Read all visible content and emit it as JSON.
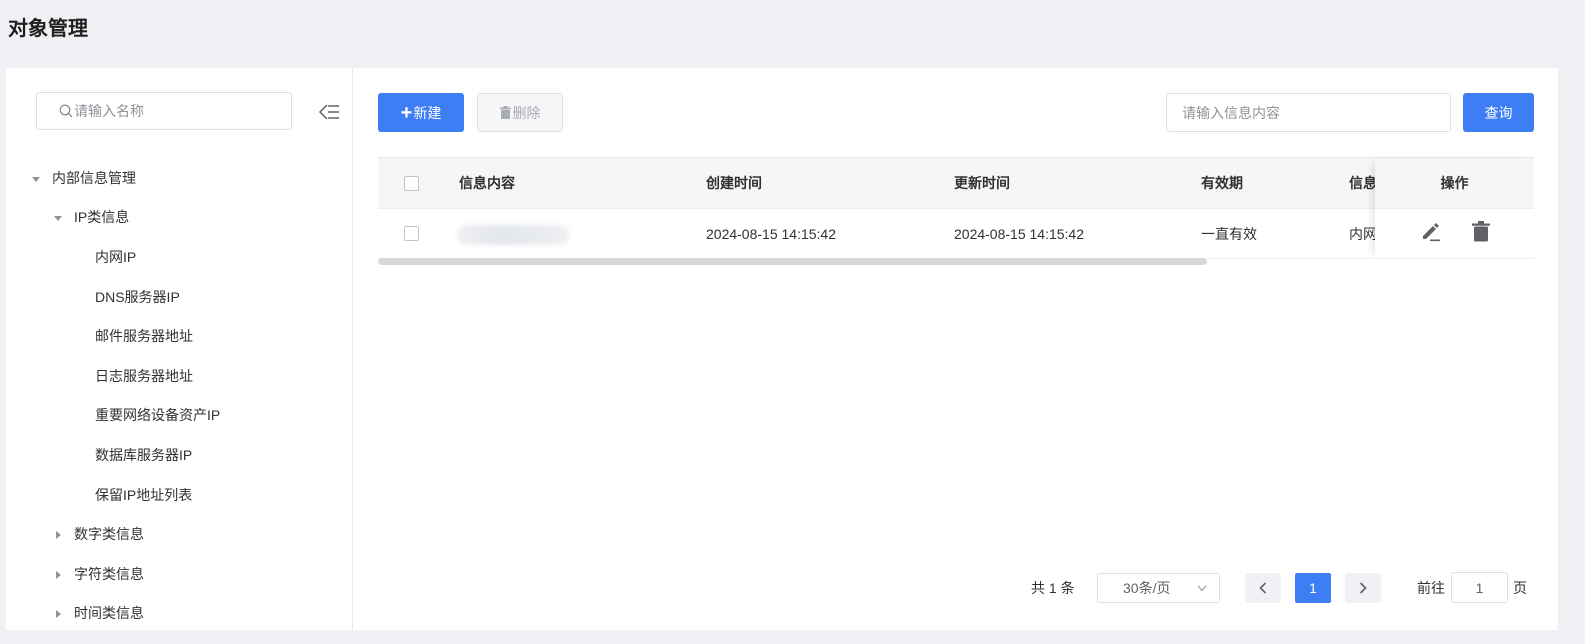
{
  "page": {
    "title": "对象管理"
  },
  "tree": {
    "search_placeholder": "请输入名称",
    "nodes": [
      {
        "label": "内部信息管理",
        "level": 1,
        "expanded": true
      },
      {
        "label": "IP类信息",
        "level": 2,
        "expanded": true
      },
      {
        "label": "内网IP",
        "level": 3
      },
      {
        "label": "DNS服务器IP",
        "level": 3
      },
      {
        "label": "邮件服务器地址",
        "level": 3
      },
      {
        "label": "日志服务器地址",
        "level": 3
      },
      {
        "label": "重要网络设备资产IP",
        "level": 3
      },
      {
        "label": "数据库服务器IP",
        "level": 3
      },
      {
        "label": "保留IP地址列表",
        "level": 3
      },
      {
        "label": "数字类信息",
        "level": 2,
        "expanded": false
      },
      {
        "label": "字符类信息",
        "level": 2,
        "expanded": false
      },
      {
        "label": "时间类信息",
        "level": 2,
        "expanded": false
      }
    ]
  },
  "toolbar": {
    "new_label": "新建",
    "delete_label": "删除",
    "search_placeholder": "请输入信息内容",
    "query_label": "查询"
  },
  "table": {
    "columns": {
      "content": "信息内容",
      "created": "创建时间",
      "updated": "更新时间",
      "validity": "有效期",
      "type": "信息",
      "actions": "操作"
    },
    "rows": [
      {
        "content": "",
        "created": "2024-08-15 14:15:42",
        "updated": "2024-08-15 14:15:42",
        "validity": "一直有效",
        "type": "内网"
      }
    ]
  },
  "pagination": {
    "total_text": "共 1 条",
    "page_size": "30条/页",
    "current_page": "1",
    "goto_label": "前往",
    "goto_value": "1",
    "page_suffix": "页"
  },
  "colors": {
    "primary": "#3d7ef5",
    "background": "#f0f1f4"
  }
}
